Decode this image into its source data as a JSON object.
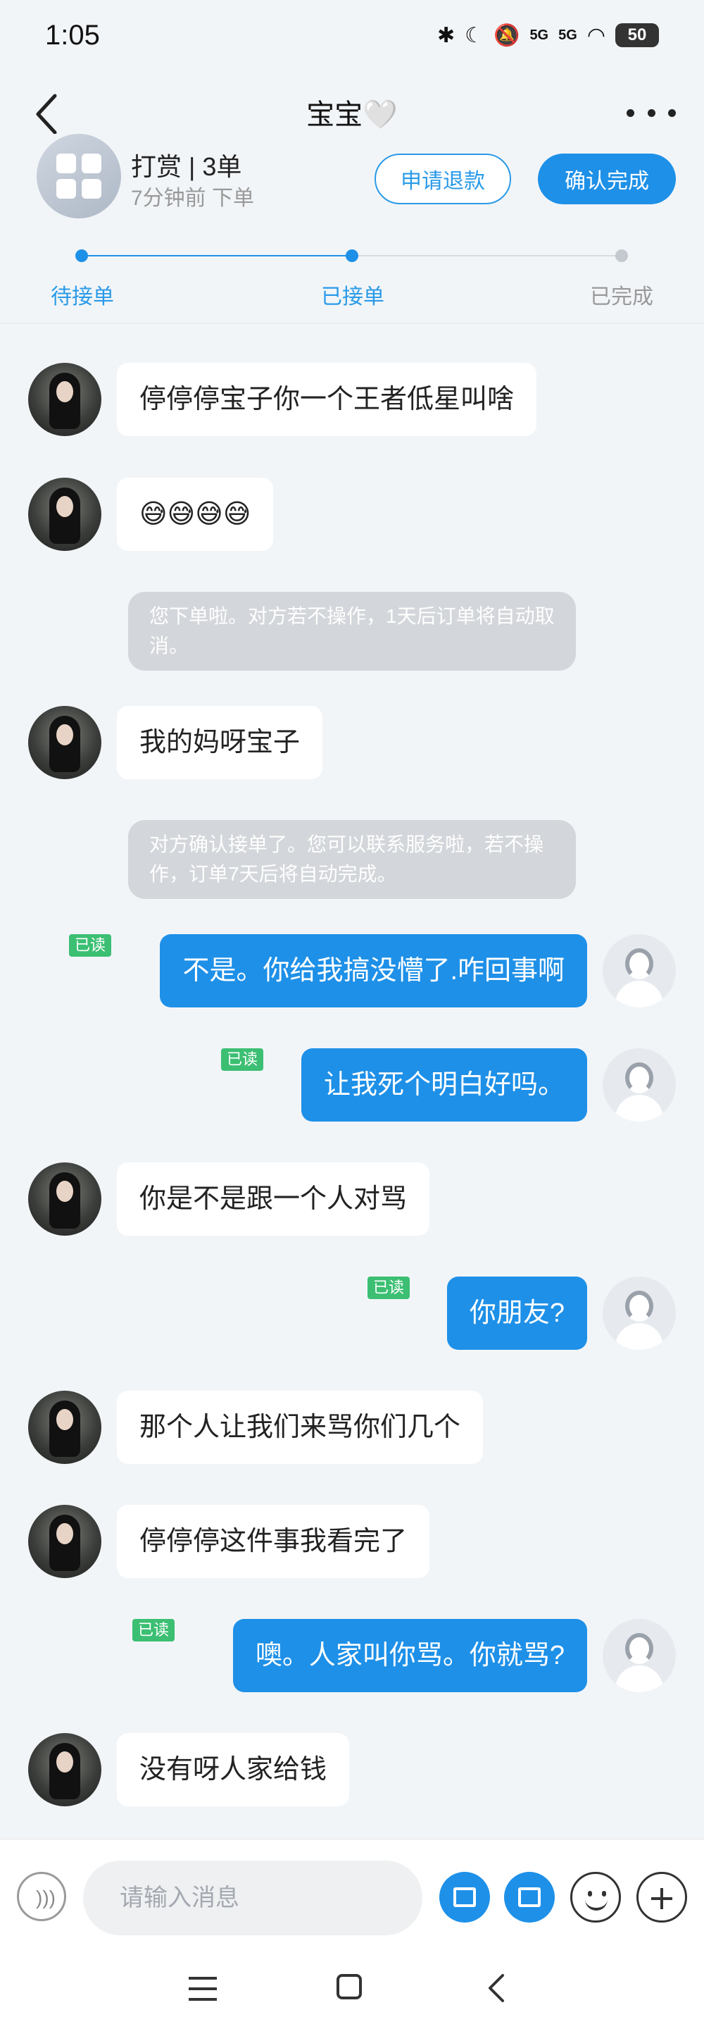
{
  "status_bar": {
    "time": "1:05",
    "signal_label": "5G",
    "battery": "50"
  },
  "nav": {
    "title": "宝宝🤍"
  },
  "order": {
    "title": "打赏 | 3单",
    "subtitle": "7分钟前 下单",
    "refund_label": "申请退款",
    "confirm_label": "确认完成",
    "steps": [
      "待接单",
      "已接单",
      "已完成"
    ],
    "current_step": 2
  },
  "messages": {
    "m1": "停停停宝子你一个王者低星叫啥",
    "m2": "😅😅😅😅",
    "sys1": "您下单啦。对方若不操作，1天后订单将自动取消。",
    "m3": "我的妈呀宝子",
    "sys2": "对方确认接单了。您可以联系服务啦，若不操作，订单7天后将自动完成。",
    "m4": "不是。你给我搞没懵了.咋回事啊",
    "m5": "让我死个明白好吗。",
    "m6": "你是不是跟一个人对骂",
    "m7": "你朋友?",
    "m8": "那个人让我们来骂你们几个",
    "m9": "停停停这件事我看完了",
    "m10": "噢。人家叫你骂。你就骂?",
    "m11": "没有呀人家给钱",
    "read_label": "已读"
  },
  "input": {
    "placeholder": "请输入消息"
  },
  "colors": {
    "accent": "#1e90e8",
    "read_badge": "#3cbf73",
    "background": "#f2f5f8"
  }
}
